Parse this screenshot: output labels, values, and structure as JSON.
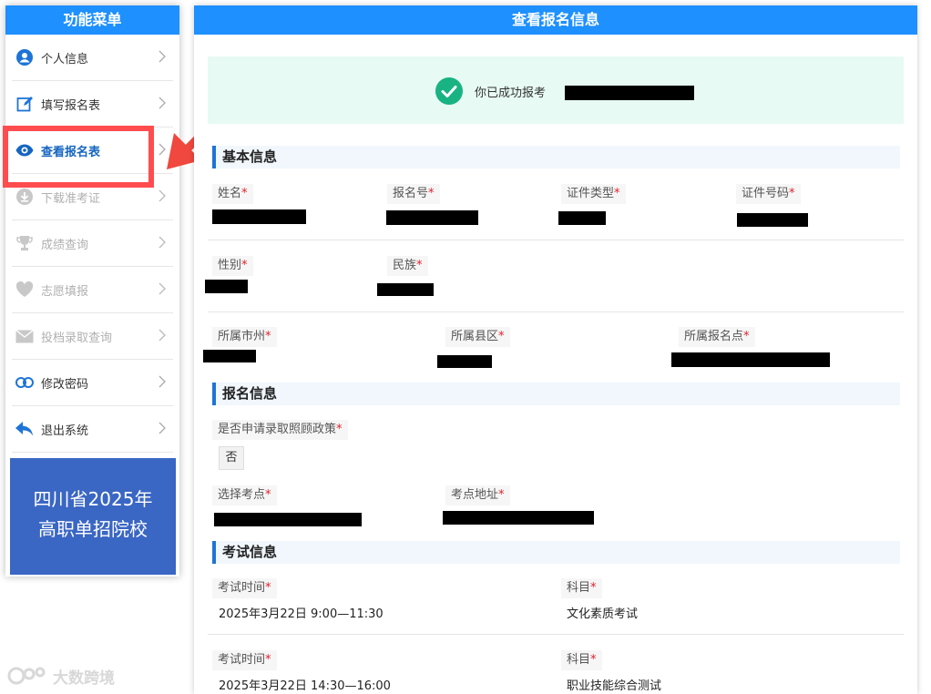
{
  "sidebar": {
    "title": "功能菜单",
    "items": [
      {
        "label": "个人信息",
        "state": "normal"
      },
      {
        "label": "填写报名表",
        "state": "normal"
      },
      {
        "label": "查看报名表",
        "state": "active"
      },
      {
        "label": "下载准考证",
        "state": "disabled"
      },
      {
        "label": "成绩查询",
        "state": "disabled"
      },
      {
        "label": "志愿填报",
        "state": "disabled"
      },
      {
        "label": "投档录取查询",
        "state": "disabled"
      },
      {
        "label": "修改密码",
        "state": "normal"
      },
      {
        "label": "退出系统",
        "state": "normal"
      }
    ],
    "promo_line1": "四川省2025年",
    "promo_line2": "高职单招院校"
  },
  "main": {
    "title": "查看报名信息",
    "success_text": "你已成功报考"
  },
  "basic_info": {
    "title": "基本信息",
    "name_label": "姓名",
    "reg_no_label": "报名号",
    "id_type_label": "证件类型",
    "id_no_label": "证件号码",
    "gender_label": "性别",
    "ethnicity_label": "民族",
    "city_label": "所属市州",
    "county_label": "所属县区",
    "site_label": "所属报名点"
  },
  "reg_info": {
    "title": "报名信息",
    "policy_label": "是否申请录取照顾政策",
    "policy_value": "否",
    "exam_site_label": "选择考点",
    "exam_addr_label": "考点地址"
  },
  "exam_info": {
    "title": "考试信息",
    "rows": [
      {
        "time_label": "考试时间",
        "time": "2025年3月22日 9:00—11:30",
        "subject_label": "科目",
        "subject": "文化素质考试"
      },
      {
        "time_label": "考试时间",
        "time": "2025年3月22日 14:30—16:00",
        "subject_label": "科目",
        "subject": "职业技能综合测试"
      }
    ]
  },
  "required_mark": "*",
  "watermark": "大数跨境",
  "colors": {
    "header_blue": "#1e90ff",
    "accent_blue": "#1e74d6",
    "success_green": "#19b383",
    "required_red": "#e0202a",
    "highlight_red": "#ff4d4f",
    "promo_blue": "#3a66c4"
  }
}
